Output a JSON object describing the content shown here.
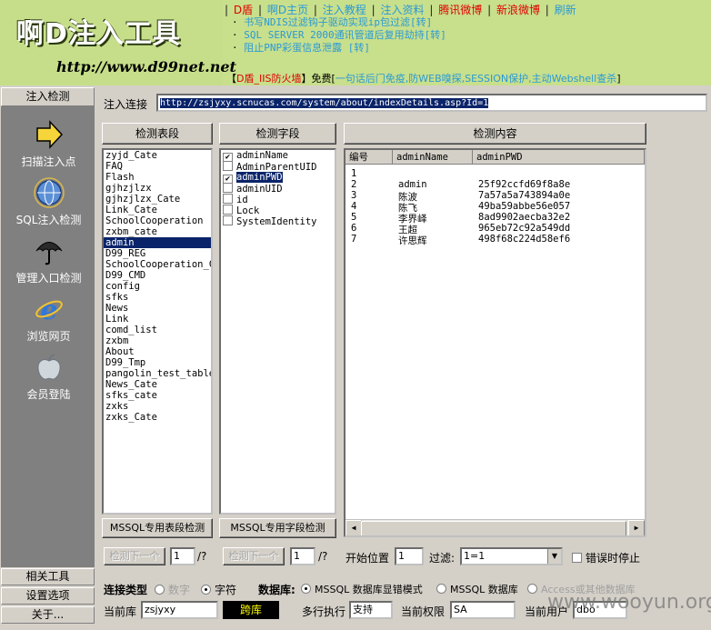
{
  "header": {
    "logo_title": "啊D注入工具",
    "logo_url": "http://www.d99net.net",
    "nav": [
      {
        "label": "D盾",
        "color": "#e00000"
      },
      {
        "label": "啊D主页",
        "color": "#2a9ad6"
      },
      {
        "label": "注入教程",
        "color": "#2a9ad6"
      },
      {
        "label": "注入资料",
        "color": "#2a9ad6"
      },
      {
        "label": "腾讯微博",
        "color": "#e00000"
      },
      {
        "label": "新浪微博",
        "color": "#e00000"
      },
      {
        "label": "刷新",
        "color": "#2a9ad6"
      }
    ],
    "news": [
      "书写NDIS过滤钩子驱动实现ip包过滤[转]",
      "SQL SERVER 2000通讯管道后复用劫持[转]",
      "阻止PNP彩蛋信息泄露 [转]"
    ],
    "promo_prefix": "【",
    "promo_link": "D盾_IIS防火墙",
    "promo_mid": "】免费[",
    "promo_text": "一句话后门免疫,防WEB嗅探,SESSION保护,主动Webshell查杀",
    "promo_end": "]"
  },
  "sidebar": {
    "header": "注入检测",
    "items": [
      {
        "label": "扫描注入点",
        "icon": "arrow-icon"
      },
      {
        "label": "SQL注入检测",
        "icon": "globe-icon"
      },
      {
        "label": "管理入口检测",
        "icon": "umbrella-icon"
      },
      {
        "label": "浏览网页",
        "icon": "ie-icon"
      },
      {
        "label": "会员登陆",
        "icon": "apple-icon"
      }
    ],
    "bottom_buttons": [
      "相关工具",
      "设置选项",
      "关于..."
    ]
  },
  "main": {
    "url_label": "注入连接",
    "url_value": "http://zsjyxy.scnucas.com/system/about/indexDetails.asp?Id=1",
    "tables_header": "检测表段",
    "fields_header": "检测字段",
    "content_header": "检测内容",
    "tables": [
      "zyjd_Cate",
      "FAQ",
      "Flash",
      "gjhzjlzx",
      "gjhzjlzx_Cate",
      "Link_Cate",
      "SchoolCooperation",
      "zxbm_cate",
      "admin",
      "D99_REG",
      "SchoolCooperation_Ca",
      "D99_CMD",
      "config",
      "sfks",
      "News",
      "Link",
      "comd_list",
      "zxbm",
      "About",
      "D99_Tmp",
      "pangolin_test_table",
      "News_Cate",
      "sfks_cate",
      "zxks",
      "zxks_Cate"
    ],
    "tables_selected_index": 8,
    "fields": [
      {
        "name": "adminName",
        "checked": true
      },
      {
        "name": "AdminParentUID",
        "checked": false
      },
      {
        "name": "adminPWD",
        "checked": true,
        "selected": true
      },
      {
        "name": "adminUID",
        "checked": false
      },
      {
        "name": "id",
        "checked": false
      },
      {
        "name": "Lock",
        "checked": false
      },
      {
        "name": "SystemIdentity",
        "checked": false
      }
    ],
    "grid": {
      "columns": [
        "编号",
        "adminName",
        "adminPWD"
      ],
      "rows": [
        [
          "1",
          "",
          ""
        ],
        [
          "2",
          "admin",
          "25f92ccfd69f8a8e"
        ],
        [
          "3",
          "陈波",
          "7a57a5a743894a0e"
        ],
        [
          "4",
          "陈飞",
          "49ba59abbe56e057"
        ],
        [
          "5",
          "李界峄",
          "8ad9902aecba32e2"
        ],
        [
          "6",
          "王超",
          "965eb72c92a549dd"
        ],
        [
          "7",
          "许思辉",
          "498f68c224d58ef6"
        ]
      ]
    },
    "mssql_table_btn": "MSSQL专用表段检测",
    "mssql_field_btn": "MSSQL专用字段检测",
    "next_btn": "检测下一个",
    "page_value": "1",
    "page_total": "/?",
    "start_label": "开始位置",
    "start_value": "1",
    "filter_label": "过滤:",
    "filter_value": "1=1",
    "stop_on_error": "错误时停止",
    "conn_type_label": "连接类型",
    "conn_types": [
      "数字",
      "字符"
    ],
    "conn_type_selected": 1,
    "db_label": "数据库:",
    "db_types": [
      "MSSQL 数据库显错模式",
      "MSSQL 数据库",
      "Access或其他数据库"
    ],
    "db_selected": 0,
    "current_db_label": "当前库",
    "current_db_value": "zsjyxy",
    "cross_db_label": "跨库",
    "multi_exec_label": "多行执行",
    "multi_exec_value": "支持",
    "perm_label": "当前权限",
    "perm_value": "SA",
    "user_label": "当前用户",
    "user_value": "dbo",
    "watermark": "www.wooyun.org"
  }
}
